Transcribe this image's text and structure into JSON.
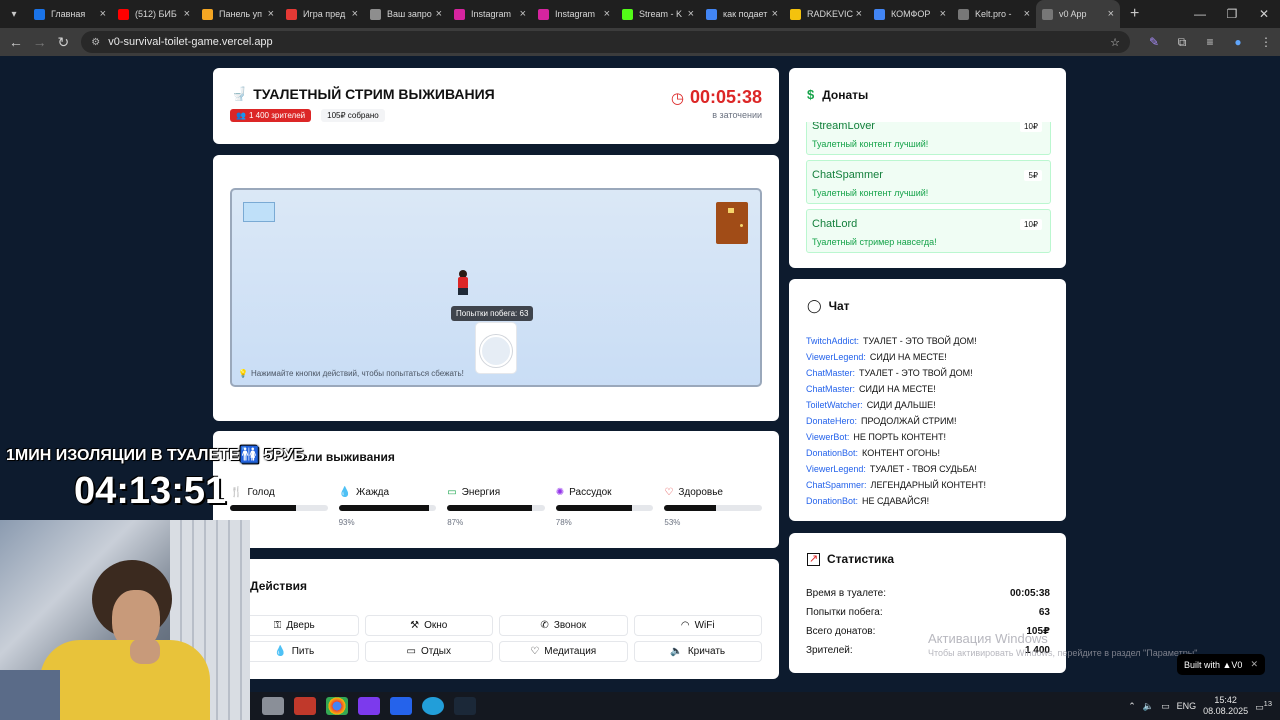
{
  "browser": {
    "tabs": [
      {
        "label": "Главная",
        "color": "#1a73e8"
      },
      {
        "label": "(512) БИБ",
        "color": "#ff0000"
      },
      {
        "label": "Панель уп",
        "color": "#f5a623"
      },
      {
        "label": "Игра пред",
        "color": "#e53935"
      },
      {
        "label": "Ваш запро",
        "color": "#8e8e8e"
      },
      {
        "label": "Instagram",
        "color": "#d6249f"
      },
      {
        "label": "Instagram",
        "color": "#d6249f"
      },
      {
        "label": "Stream - K",
        "color": "#53fc18"
      },
      {
        "label": "как подает",
        "color": "#4285f4"
      },
      {
        "label": "RADKEVIC",
        "color": "#f4c20d"
      },
      {
        "label": "КОМФОР",
        "color": "#4285f4"
      },
      {
        "label": "Kelt.pro -",
        "color": "#777777"
      },
      {
        "label": "v0 App",
        "color": "#777777"
      }
    ],
    "url": "v0-survival-toilet-game.vercel.app"
  },
  "header": {
    "title": "ТУАЛЕТНЫЙ СТРИМ ВЫЖИВАНИЯ",
    "viewers_badge": "1 400 зрителей",
    "collected_badge": "105₽ собрано",
    "timer": "00:05:38",
    "timer_caption": "в заточении"
  },
  "game": {
    "tooltip": "Попытки побега: 63",
    "hint": "Нажимайте кнопки действий, чтобы попытаться сбежать!"
  },
  "stats_section": {
    "title": "Показатели выживания",
    "visible_title": "тели выживания",
    "items": [
      {
        "label": "Голод",
        "icon": "food-icon",
        "fill": 0.68,
        "pct": ""
      },
      {
        "label": "Жажда",
        "icon": "drop-icon",
        "fill": 0.93,
        "pct": "93%"
      },
      {
        "label": "Энергия",
        "icon": "battery-icon",
        "fill": 0.87,
        "pct": "87%"
      },
      {
        "label": "Рассудок",
        "icon": "brain-icon",
        "fill": 0.78,
        "pct": "78%"
      },
      {
        "label": "Здоровье",
        "icon": "heart-icon",
        "fill": 0.53,
        "pct": "53%"
      }
    ]
  },
  "actions": {
    "title": "Действия",
    "buttons": [
      {
        "label": "Дверь",
        "icon": "key-icon"
      },
      {
        "label": "Окно",
        "icon": "hammer-icon"
      },
      {
        "label": "Звонок",
        "icon": "phone-icon"
      },
      {
        "label": "WiFi",
        "icon": "wifi-icon"
      },
      {
        "label": "Пить",
        "icon": "drop-icon"
      },
      {
        "label": "Отдых",
        "icon": "battery-icon"
      },
      {
        "label": "Медитация",
        "icon": "heart-icon"
      },
      {
        "label": "Кричать",
        "icon": "speaker-icon"
      }
    ]
  },
  "donations": {
    "title": "Донаты",
    "items": [
      {
        "name": "StreamLover",
        "amount": "10₽",
        "message": "Туалетный контент лучший!"
      },
      {
        "name": "ChatSpammer",
        "amount": "5₽",
        "message": "Туалетный контент лучший!"
      },
      {
        "name": "ChatLord",
        "amount": "10₽",
        "message": "Туалетный стример навсегда!"
      }
    ]
  },
  "chat": {
    "title": "Чат",
    "messages": [
      {
        "user": "TwitchAddict:",
        "text": "ТУАЛЕТ - ЭТО ТВОЙ ДОМ!"
      },
      {
        "user": "ViewerLegend:",
        "text": "СИДИ НА МЕСТЕ!"
      },
      {
        "user": "ChatMaster:",
        "text": "ТУАЛЕТ - ЭТО ТВОЙ ДОМ!"
      },
      {
        "user": "ChatMaster:",
        "text": "СИДИ НА МЕСТЕ!"
      },
      {
        "user": "ToiletWatcher:",
        "text": "СИДИ ДАЛЬШЕ!"
      },
      {
        "user": "DonateHero:",
        "text": "ПРОДОЛЖАЙ СТРИМ!"
      },
      {
        "user": "ViewerBot:",
        "text": "НЕ ПОРТЬ КОНТЕНТ!"
      },
      {
        "user": "DonationBot:",
        "text": "КОНТЕНТ ОГОНЬ!"
      },
      {
        "user": "ViewerLegend:",
        "text": "ТУАЛЕТ - ТВОЯ СУДЬБА!"
      },
      {
        "user": "ChatSpammer:",
        "text": "ЛЕГЕНДАРНЫЙ КОНТЕНТ!"
      },
      {
        "user": "DonationBot:",
        "text": "НЕ СДАВАЙСЯ!"
      }
    ]
  },
  "statistics": {
    "title": "Статистика",
    "rows": [
      {
        "label": "Время в туалете:",
        "value": "00:05:38"
      },
      {
        "label": "Попытки побега:",
        "value": "63"
      },
      {
        "label": "Всего донатов:",
        "value": "105₽"
      },
      {
        "label": "Зрителей:",
        "value": "1 400"
      }
    ]
  },
  "overlay": {
    "headline": "1МИН ИЗОЛЯЦИИ В ТУАЛЕТЕ🚻 5РУБ",
    "timer": "04:13:51"
  },
  "watermark": {
    "line1": "Активация Windows",
    "line2": "Чтобы активировать Windows, перейдите в раздел \"Параметры\"."
  },
  "built_with": "Built with ▲V0",
  "system": {
    "lang": "ENG",
    "time": "15:42",
    "date": "08.08.2025",
    "notifications": "13"
  },
  "colors": {
    "accent_red": "#dc2626",
    "donate_green": "#16a34a",
    "chat_blue": "#2563eb",
    "page_bg": "#0d1b2e"
  }
}
